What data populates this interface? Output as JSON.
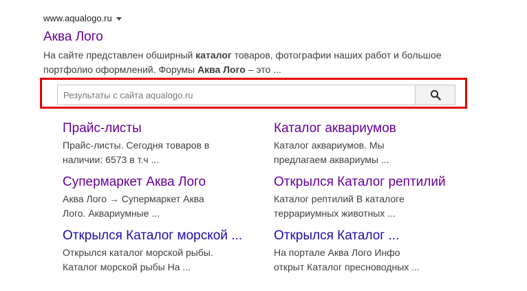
{
  "result": {
    "display_url": "www.aqualogo.ru",
    "title": "Аква Лого",
    "snippet": {
      "part1": "На сайте представлен обширный ",
      "bold1": "каталог",
      "part2": " товаров, фотографии наших работ и большое портфолио оформлений. Форумы ",
      "bold2": "Аква Лого",
      "part3": " – это ..."
    }
  },
  "site_search": {
    "placeholder": "Результаты с сайта aqualogo.ru",
    "value": "",
    "button_icon": "search-icon",
    "highlight_color": "#e00000"
  },
  "sitelinks": [
    {
      "title": "Прайс-листы",
      "visited": true,
      "desc": "Прайс-листы. Сегодня товаров в\nналичии: 6573 в т.ч ..."
    },
    {
      "title": "Каталог аквариумов",
      "visited": true,
      "desc": "Каталог аквариумов. Мы\nпредлагаем аквариумы ..."
    },
    {
      "title": "Супермаркет Аква Лого",
      "visited": true,
      "desc": "Аква Лого → Супермаркет Аква\nЛого. Аквариумные ..."
    },
    {
      "title": "Открылся Каталог рептилий",
      "visited": true,
      "desc": "Каталог рептилий В каталоге\nтеррариумных животных ..."
    },
    {
      "title": "Открылся Каталог морской ...",
      "visited": false,
      "desc": "Открылся каталог морской рыбы.\nКаталог морской рыбы На ..."
    },
    {
      "title": "Открылся Каталог ...",
      "visited": false,
      "desc": "На портале Аква Лого Инфо\nоткрыт Каталог пресноводных ..."
    }
  ],
  "colors": {
    "visited_link": "#660099",
    "link": "#1a0dab",
    "text": "#3c4043"
  }
}
